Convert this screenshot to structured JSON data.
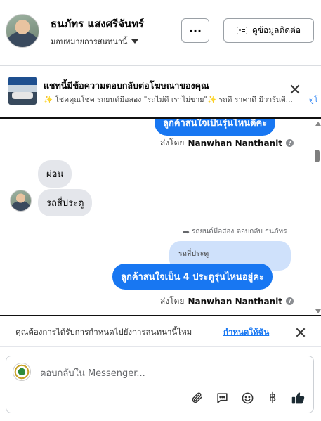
{
  "header": {
    "user_name": "ธนภัทร แสงศรีจันทร์",
    "assign_label": "มอบหมายการสนทนานี้",
    "more_label": "···",
    "contact_label": "ดูข้อมูลติดต่อ"
  },
  "ad_banner": {
    "title": "แชทนี้มีข้อความตอบกลับต่อโฆษณาของคุณ",
    "subtitle": "✨ โชคคูณโชค รถยนต์มือสอง \"รถไม่ดี เราไม่ขาย\"✨ รถดี ราคาดี มีวารันตี...",
    "link_label": "ดูโ"
  },
  "conversation": {
    "top_bubble": "ลูกค้าสนใจเป็นรุ่นไหนดีคะ",
    "sent_by_prefix": "ส่งโดย",
    "agent_name": "Nanwhan Nanthanit",
    "incoming": [
      "ผ่อน",
      "รถสี่ประตู"
    ],
    "replied_label": "รถยนต์มือสอง ตอบกลับ ธนภัทร",
    "quoted_text": "รถสี่ประตู",
    "reply_bubble": "ลูกค้าสนใจเป็น 4 ประตูรุ่นไหนอยู่คะ",
    "info_glyph": "?"
  },
  "assign_prompt": {
    "text": "คุณต้องการได้รับการกำหนดไปยังการสนทนานี้ไหม",
    "link": "กำหนดให้ฉัน"
  },
  "composer": {
    "placeholder": "ตอบกลับใน Messenger...",
    "baht_glyph": "฿"
  },
  "colors": {
    "accent": "#1877f2",
    "incoming_bubble": "#e4e6eb",
    "quoted_bubble": "#cfe1fb"
  }
}
